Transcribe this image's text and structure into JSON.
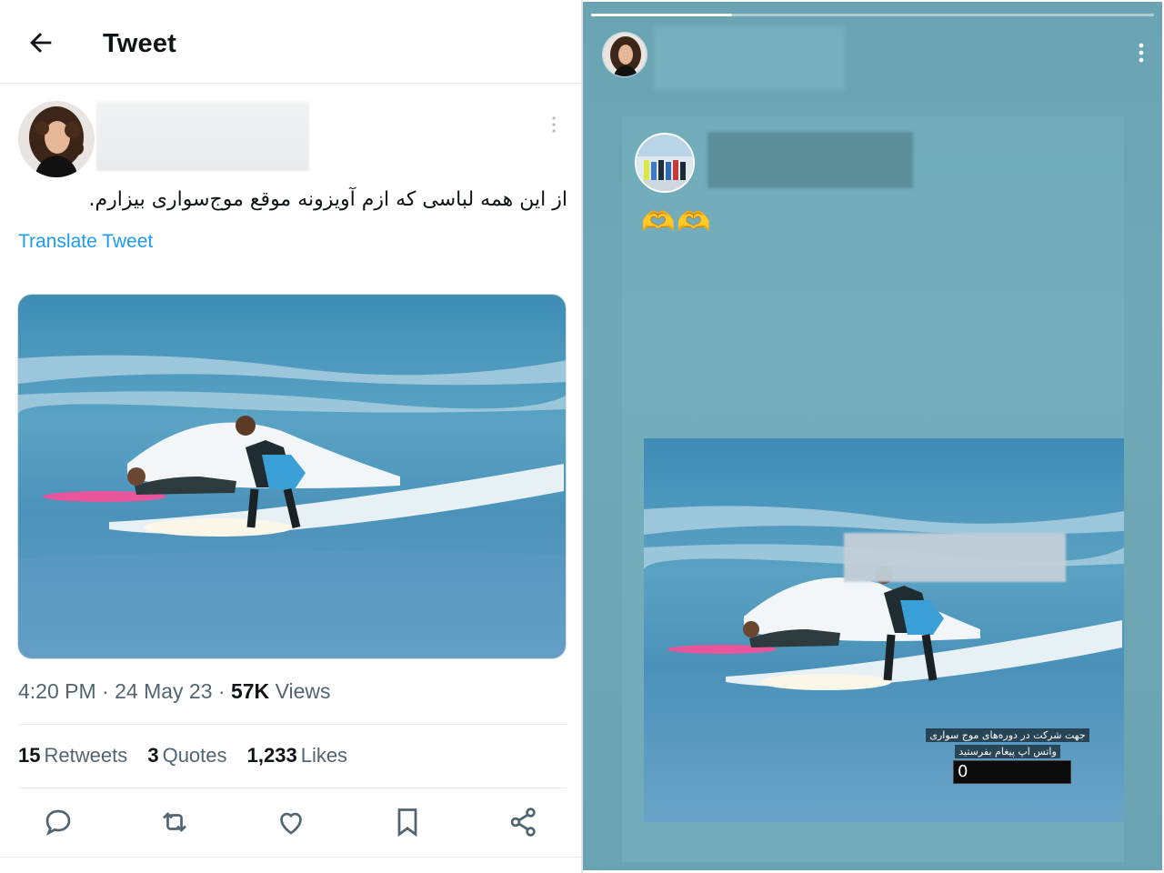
{
  "tweet": {
    "header_title": "Tweet",
    "text": "از این همه لباسی که ازم آویزونه موقع موج‌سواری بیزارم.",
    "translate_label": "Translate Tweet",
    "time": "4:20 PM",
    "separator": "·",
    "date": "24 May 23",
    "views_count": "57K",
    "views_label": "Views",
    "retweets_count": "15",
    "retweets_label": "Retweets",
    "quotes_count": "3",
    "quotes_label": "Quotes",
    "likes_count": "1,233",
    "likes_label": "Likes",
    "icons": [
      "back-arrow-icon",
      "more-vertical-icon",
      "reply-icon",
      "retweet-icon",
      "like-icon",
      "bookmark-icon",
      "share-icon"
    ],
    "colors": {
      "link": "#1d9bf0",
      "text": "#0f1419",
      "muted": "#536471"
    }
  },
  "story": {
    "progress": 0.25,
    "emoji": "🫶🫶",
    "promo_line1": "جهت شرکت در دوره‌های موج سواری",
    "promo_line2": "واتس اپ پیغام بفرستید",
    "promo_phone_visible": "0",
    "icons": [
      "more-vertical-icon"
    ],
    "colors": {
      "background": "#6ca5b4"
    }
  }
}
